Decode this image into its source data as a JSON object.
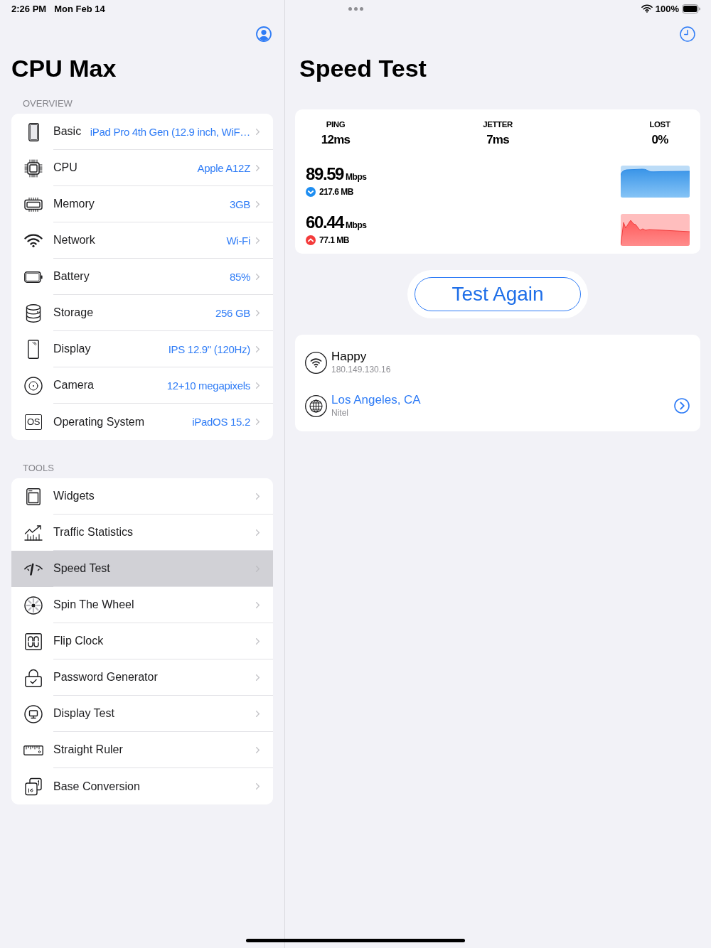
{
  "status_bar": {
    "time": "2:26 PM",
    "date": "Mon Feb 14",
    "battery": "100%"
  },
  "sidebar": {
    "title": "CPU Max",
    "sections": [
      {
        "header": "OVERVIEW",
        "items": [
          {
            "label": "Basic",
            "value": "iPad Pro 4th Gen (12.9 inch, WiF…",
            "selected": false
          },
          {
            "label": "CPU",
            "value": "Apple A12Z",
            "selected": false
          },
          {
            "label": "Memory",
            "value": "3GB",
            "selected": false
          },
          {
            "label": "Network",
            "value": "Wi-Fi",
            "selected": false
          },
          {
            "label": "Battery",
            "value": "85%",
            "selected": false
          },
          {
            "label": "Storage",
            "value": "256 GB",
            "selected": false
          },
          {
            "label": "Display",
            "value": "IPS 12.9\" (120Hz)",
            "selected": false
          },
          {
            "label": "Camera",
            "value": "12+10 megapixels",
            "selected": false
          },
          {
            "label": "Operating System",
            "value": "iPadOS 15.2",
            "selected": false,
            "icon_text": "OS"
          }
        ]
      },
      {
        "header": "TOOLS",
        "items": [
          {
            "label": "Widgets",
            "selected": false
          },
          {
            "label": "Traffic Statistics",
            "selected": false
          },
          {
            "label": "Speed Test",
            "selected": true
          },
          {
            "label": "Spin The Wheel",
            "selected": false
          },
          {
            "label": "Flip Clock",
            "selected": false
          },
          {
            "label": "Password Generator",
            "selected": false
          },
          {
            "label": "Display Test",
            "selected": false
          },
          {
            "label": "Straight Ruler",
            "selected": false
          },
          {
            "label": "Base Conversion",
            "selected": false
          }
        ]
      }
    ]
  },
  "speed_test": {
    "title": "Speed Test",
    "metrics": [
      {
        "label": "PING",
        "value": "12ms"
      },
      {
        "label": "JETTER",
        "value": "7ms"
      },
      {
        "label": "LOST",
        "value": "0%"
      }
    ],
    "transfers": [
      {
        "kind": "download",
        "speed": "89.59",
        "unit": "Mbps",
        "amount": "217.6 MB"
      },
      {
        "kind": "upload",
        "speed": "60.44",
        "unit": "Mbps",
        "amount": "77.1 MB"
      }
    ],
    "button": "Test Again",
    "connection": [
      {
        "kind": "wifi",
        "name": "Happy",
        "detail": "180.149.130.16"
      },
      {
        "kind": "server",
        "name": "Los Angeles, CA",
        "detail": "Nitel"
      }
    ]
  }
}
